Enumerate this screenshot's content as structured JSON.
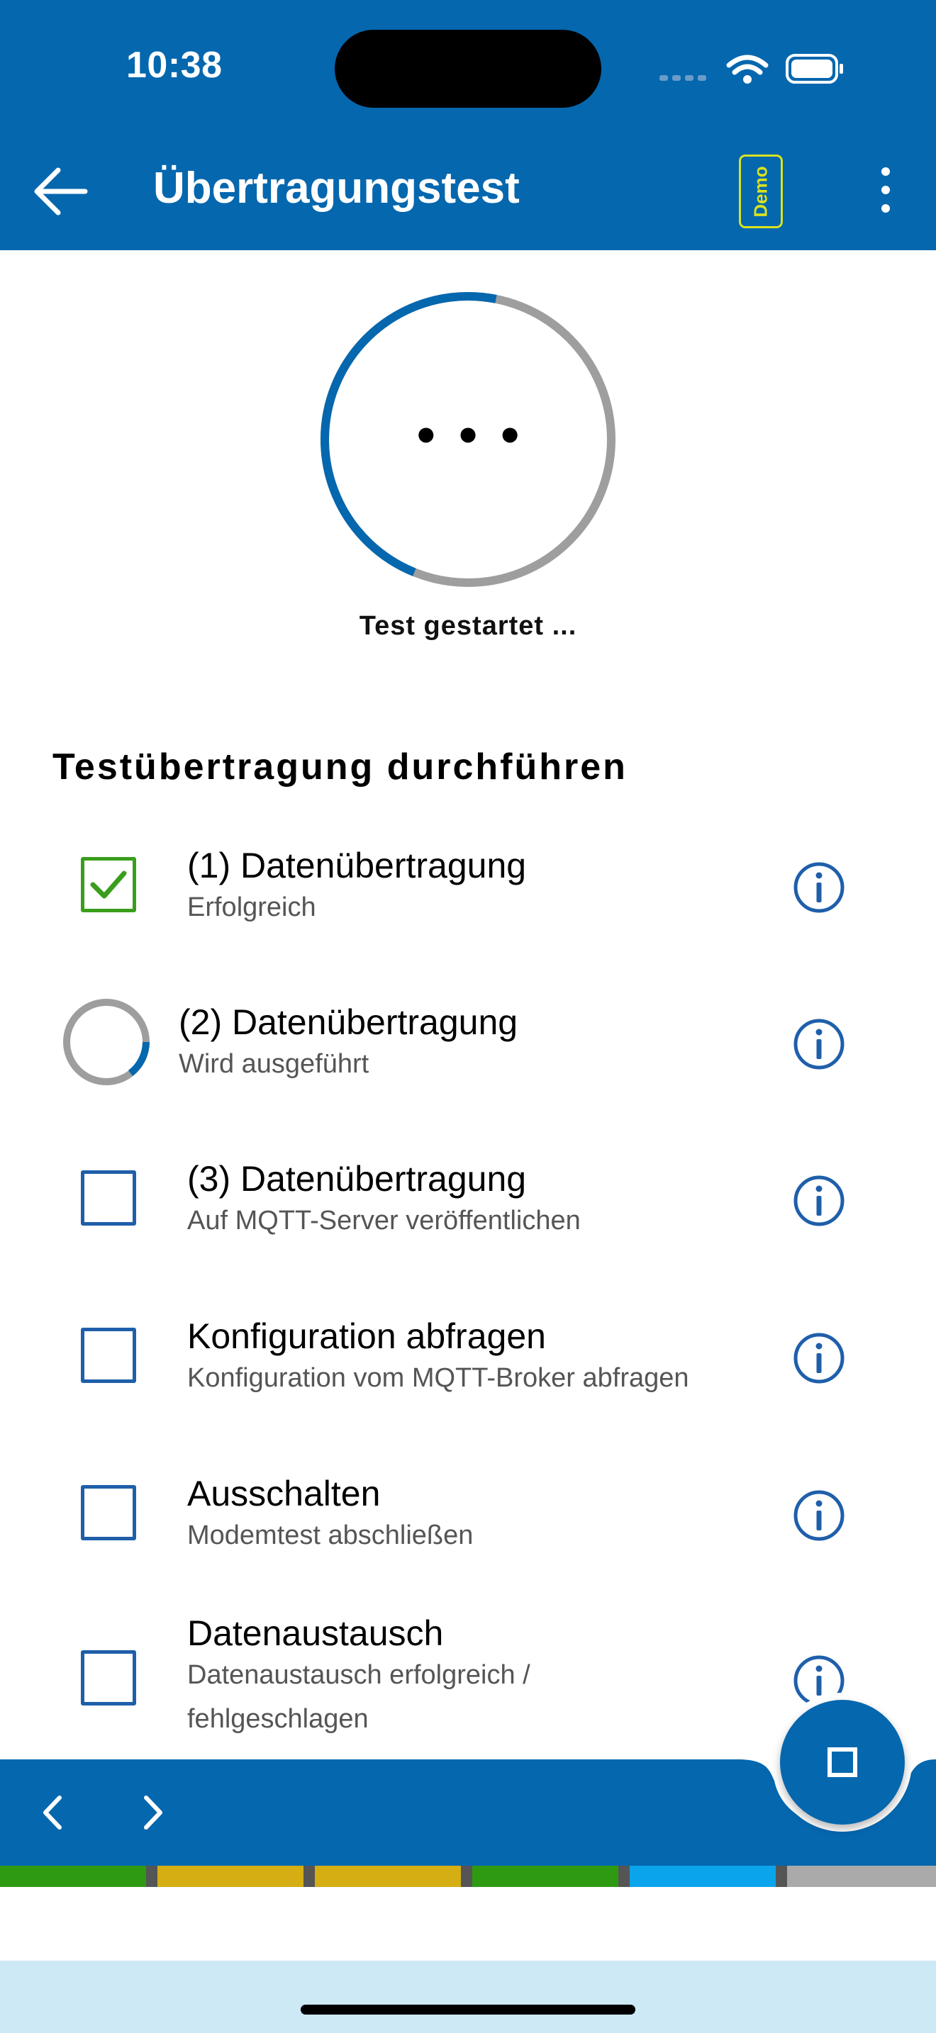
{
  "status_bar": {
    "time": "10:38"
  },
  "header": {
    "title": "Übertragungstest",
    "badge": "Demo"
  },
  "ring": {
    "status": "Test gestartet ...",
    "dots": "• • •",
    "progress": 0.47
  },
  "section": {
    "title": "Testübertragung durchführen"
  },
  "steps": [
    {
      "title": "(1) Datenübertragung",
      "subtitle": "Erfolgreich",
      "state": "done"
    },
    {
      "title": "(2) Datenübertragung",
      "subtitle": "Wird ausgeführt",
      "state": "running"
    },
    {
      "title": "(3) Datenübertragung",
      "subtitle": "Auf MQTT-Server veröffentlichen",
      "state": "pending"
    },
    {
      "title": "Konfiguration abfragen",
      "subtitle": "Konfiguration vom MQTT-Broker abfragen",
      "state": "pending"
    },
    {
      "title": "Ausschalten",
      "subtitle": "Modemtest abschließen",
      "state": "pending"
    },
    {
      "title": "Datenaustausch",
      "subtitle": "Datenaustausch erfolgreich / fehlgeschlagen",
      "state": "pending"
    }
  ],
  "icons": {
    "back": "back-arrow-icon",
    "menu": "more-vertical-icon",
    "info": "info-icon",
    "check": "checkmark-icon",
    "stop": "stop-icon",
    "prev": "chevron-left-icon",
    "next": "chevron-right-icon"
  },
  "colors": {
    "primary": "#0567AE",
    "badge": "#D9E21F",
    "success": "#3A9E1C",
    "ring_track": "#9E9E9E",
    "strip": [
      "#2E9A12",
      "#D4AE13",
      "#D4AE13",
      "#2E9A12",
      "#0AA4EC",
      "#AAAAAA"
    ]
  }
}
